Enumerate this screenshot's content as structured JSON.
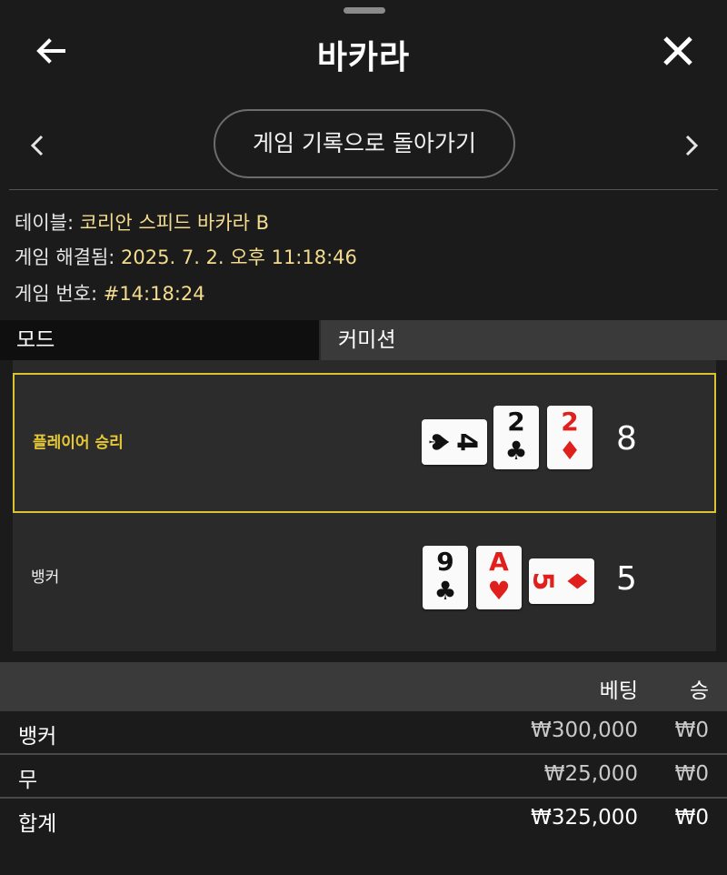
{
  "header": {
    "title": "바카라"
  },
  "nav": {
    "return_label": "게임 기록으로 돌아가기"
  },
  "info": {
    "table_label": "테이블:",
    "table_value": "코리안 스피드 바카라 B",
    "resolved_label": "게임 해결됨:",
    "resolved_value": "2025. 7. 2. 오후 11:18:46",
    "number_label": "게임 번호:",
    "number_value": "#14:18:24"
  },
  "mode": {
    "label": "모드",
    "value": "커미션"
  },
  "hands": {
    "player": {
      "label": "플레이어 승리",
      "score": "8",
      "cards": [
        {
          "rank": "4",
          "suit": "♠",
          "color": "black",
          "orientation": "sideways"
        },
        {
          "rank": "2",
          "suit": "♣",
          "color": "black",
          "orientation": "upright"
        },
        {
          "rank": "2",
          "suit": "♦",
          "color": "red",
          "orientation": "upright"
        }
      ]
    },
    "banker": {
      "label": "뱅커",
      "score": "5",
      "cards": [
        {
          "rank": "9",
          "suit": "♣",
          "color": "black",
          "orientation": "upright"
        },
        {
          "rank": "A",
          "suit": "♥",
          "color": "red",
          "orientation": "upright"
        },
        {
          "rank": "5",
          "suit": "♦",
          "color": "red",
          "orientation": "sideways"
        }
      ]
    }
  },
  "bets": {
    "col_bet": "베팅",
    "col_win": "승",
    "rows": [
      {
        "label": "뱅커",
        "bet": "₩300,000",
        "win": "₩0"
      },
      {
        "label": "무",
        "bet": "₩25,000",
        "win": "₩0"
      }
    ],
    "total": {
      "label": "합계",
      "bet": "₩325,000",
      "win": "₩0"
    }
  }
}
